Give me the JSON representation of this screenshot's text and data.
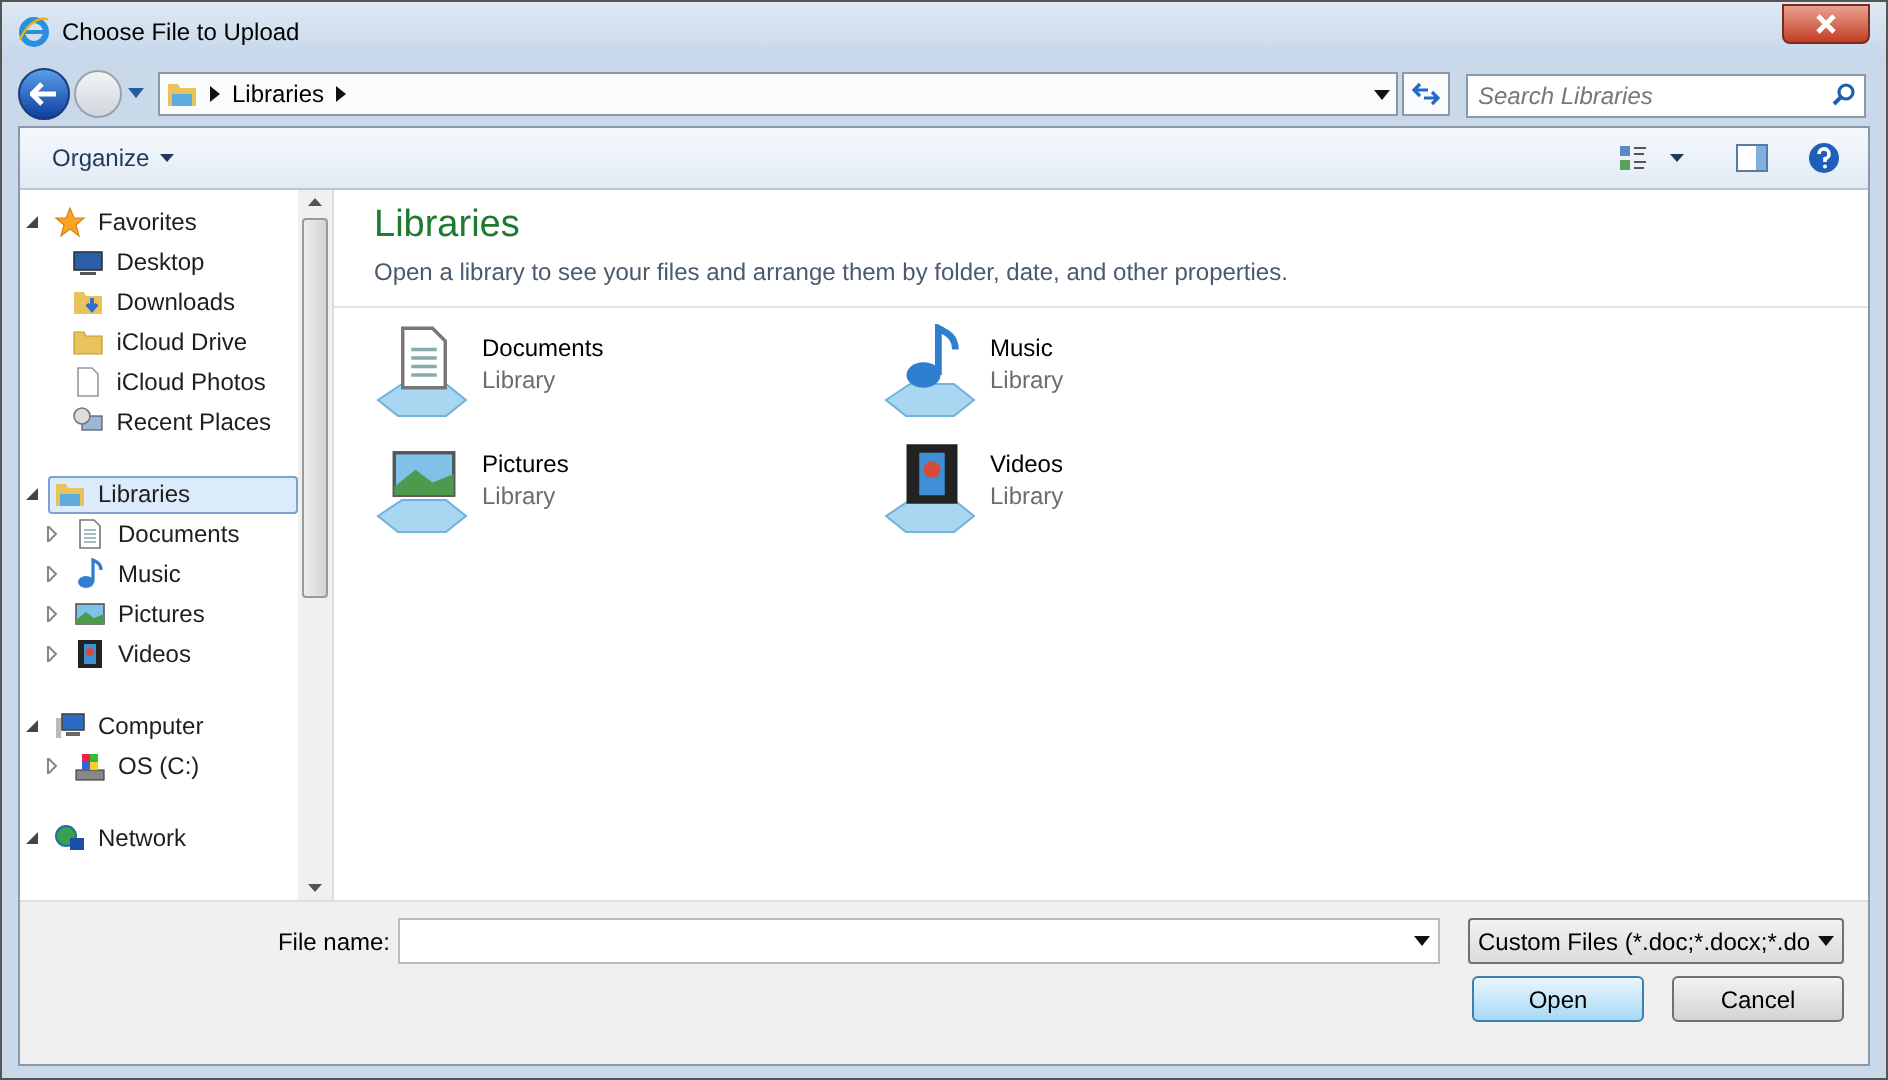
{
  "window": {
    "title": "Choose File to Upload"
  },
  "address": {
    "crumbs": [
      "Libraries"
    ]
  },
  "search": {
    "placeholder": "Search Libraries"
  },
  "toolbar": {
    "organize": "Organize"
  },
  "nav": [
    {
      "label": "Favorites",
      "kind": "star",
      "expanded": true,
      "selected": false,
      "children": [
        {
          "label": "Desktop",
          "kind": "desktop",
          "selected": false
        },
        {
          "label": "Downloads",
          "kind": "download",
          "selected": false
        },
        {
          "label": "iCloud Drive",
          "kind": "folder",
          "selected": false
        },
        {
          "label": "iCloud Photos",
          "kind": "file",
          "selected": false
        },
        {
          "label": "Recent Places",
          "kind": "recent",
          "selected": false
        }
      ]
    },
    {
      "label": "Libraries",
      "kind": "library",
      "expanded": true,
      "selected": true,
      "children": [
        {
          "label": "Documents",
          "kind": "documents",
          "selected": false,
          "expanded": false
        },
        {
          "label": "Music",
          "kind": "music",
          "selected": false,
          "expanded": false
        },
        {
          "label": "Pictures",
          "kind": "pictures",
          "selected": false,
          "expanded": false
        },
        {
          "label": "Videos",
          "kind": "videos",
          "selected": false,
          "expanded": false
        }
      ]
    },
    {
      "label": "Computer",
      "kind": "computer",
      "expanded": true,
      "selected": false,
      "children": [
        {
          "label": "OS (C:)",
          "kind": "drive",
          "selected": false,
          "expanded": false
        }
      ]
    },
    {
      "label": "Network",
      "kind": "network",
      "expanded": true,
      "selected": false
    }
  ],
  "content": {
    "title": "Libraries",
    "description": "Open a library to see your files and arrange them by folder, date, and other properties.",
    "items": [
      {
        "name": "Documents",
        "type": "Library",
        "kind": "documents"
      },
      {
        "name": "Music",
        "type": "Library",
        "kind": "music"
      },
      {
        "name": "Pictures",
        "type": "Library",
        "kind": "pictures"
      },
      {
        "name": "Videos",
        "type": "Library",
        "kind": "videos"
      }
    ]
  },
  "footer": {
    "file_name_label": "File name:",
    "filter": "Custom Files (*.doc;*.docx;*.do",
    "open": "Open",
    "cancel": "Cancel"
  }
}
